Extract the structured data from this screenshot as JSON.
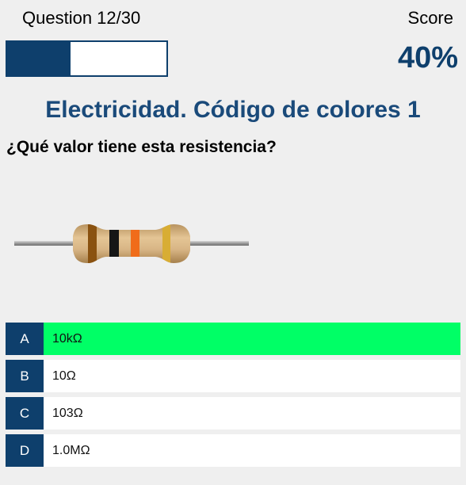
{
  "header": {
    "question_counter": "Question 12/30",
    "score_label": "Score",
    "score_value": "40%",
    "progress_fraction": 0.4
  },
  "quiz": {
    "title": "Electricidad. Código de colores 1",
    "question": "¿Qué valor tiene esta resistencia?"
  },
  "resistor": {
    "bands": [
      "brown",
      "black",
      "orange",
      "gold"
    ],
    "band_colors": [
      "#8a5210",
      "#161616",
      "#f06c1a",
      "#d8ad34"
    ],
    "body_color": "#d8b585",
    "lead_color": "#a8a8a8"
  },
  "answers": [
    {
      "letter": "A",
      "text": "10kΩ",
      "correct": true
    },
    {
      "letter": "B",
      "text": "10Ω",
      "correct": false
    },
    {
      "letter": "C",
      "text": "103Ω",
      "correct": false
    },
    {
      "letter": "D",
      "text": "1.0MΩ",
      "correct": false
    }
  ],
  "colors": {
    "primary": "#0e3f6c",
    "title": "#1a4a7a",
    "correct_highlight": "#00ff66",
    "background": "#efefef"
  }
}
